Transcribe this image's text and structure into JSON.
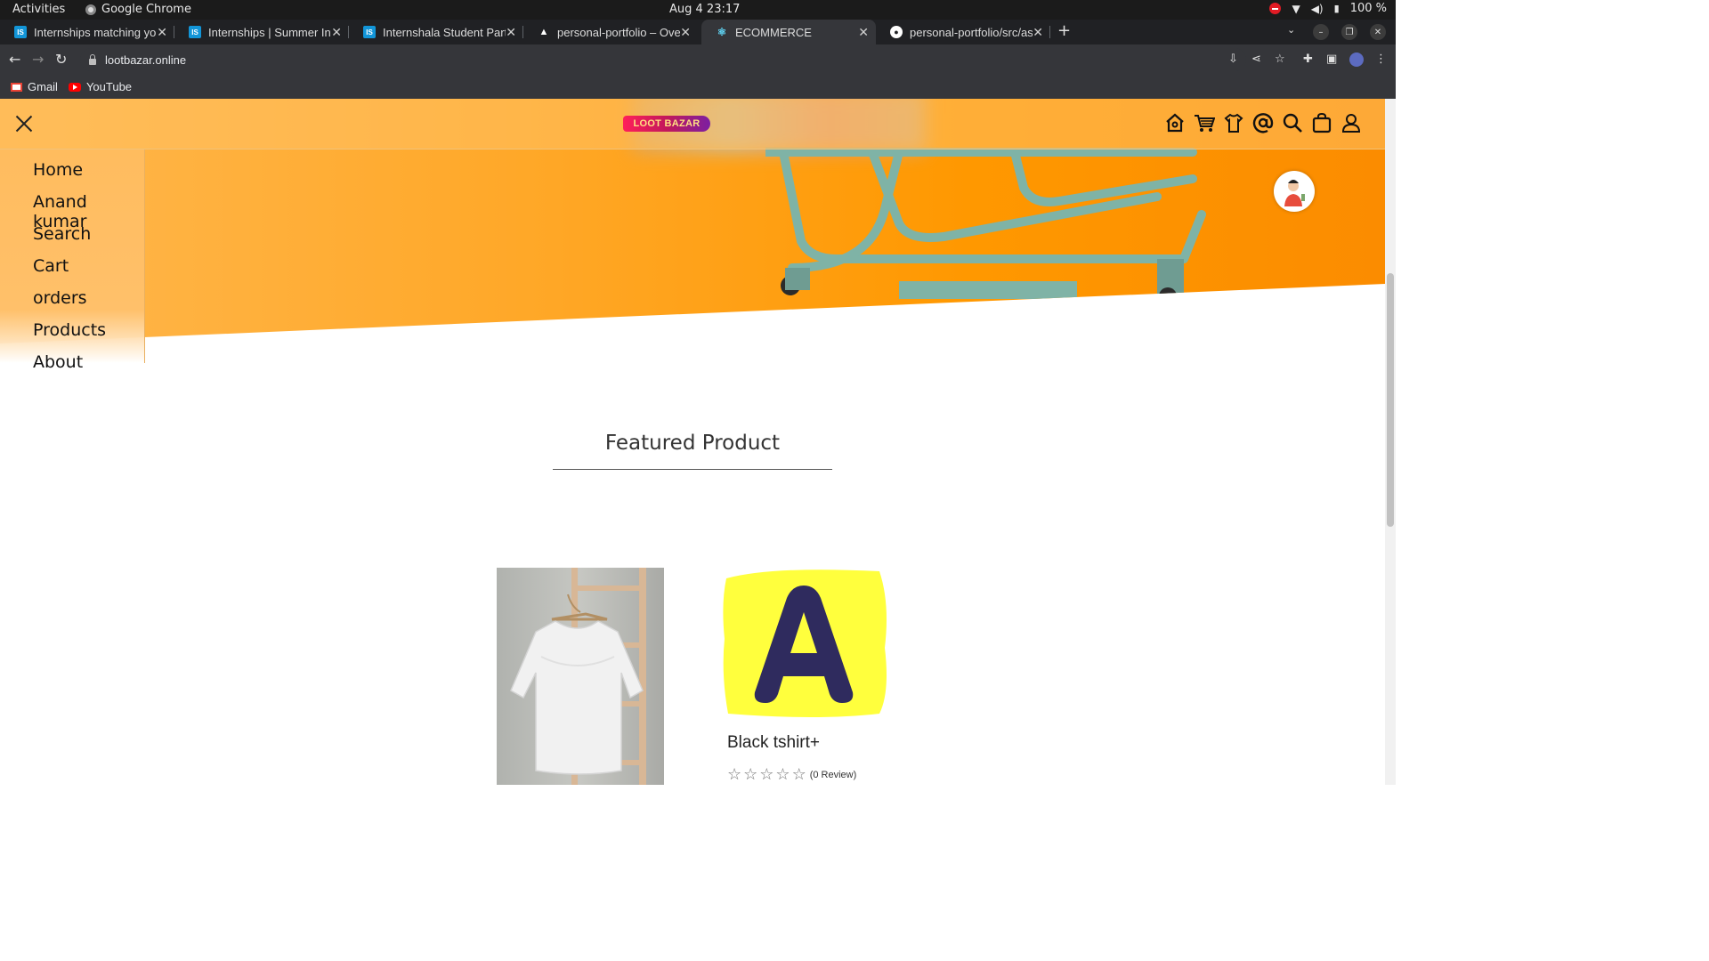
{
  "system_bar": {
    "activities": "Activities",
    "app_name": "Google Chrome",
    "clock": "Aug 4  23:17",
    "battery": "100 %"
  },
  "tabs": [
    {
      "title": "Internships matching you",
      "favicon": "internshala-icon",
      "color": "#1295d8",
      "fav_text": "IS"
    },
    {
      "title": "Internships | Summer Inte",
      "favicon": "internshala-icon",
      "color": "#1295d8",
      "fav_text": "IS"
    },
    {
      "title": "Internshala Student Partr",
      "favicon": "internshala-icon",
      "color": "#1295d8",
      "fav_text": "IS"
    },
    {
      "title": "personal-portfolio – Over",
      "favicon": "vercel-icon",
      "color": "#000000",
      "fav_text": "▲"
    },
    {
      "title": "ECOMMERCE",
      "favicon": "react-icon",
      "color": "#35363a",
      "fav_text": "⚛"
    },
    {
      "title": "personal-portfolio/src/as",
      "favicon": "github-icon",
      "color": "#202124",
      "fav_text": "●"
    }
  ],
  "active_tab_index": 4,
  "address_bar": {
    "url": "lootbazar.online"
  },
  "bookmarks": [
    {
      "label": "Gmail",
      "icon": "gmail-icon"
    },
    {
      "label": "YouTube",
      "icon": "youtube-icon"
    }
  ],
  "site": {
    "logo_text": "LOOT BAZAR",
    "nav_icons": [
      "home-icon",
      "cart-icon",
      "tshirt-icon",
      "at-icon",
      "search-icon",
      "bag-icon",
      "user-icon"
    ],
    "menu": [
      "Home",
      "Anand kumar",
      "Search",
      "Cart",
      "orders",
      "Products",
      "About"
    ],
    "section_title": "Featured Product",
    "products": [
      {
        "name": "Black tshirt+",
        "rating": 0,
        "reviews": "(0 Review)"
      }
    ],
    "brand_letter": "A"
  },
  "colors": {
    "hero_orange": "#ffa726",
    "brand_pink": "#ff1f5a",
    "brand_yellow": "#ffff3d",
    "brand_navy": "#2f2b5e"
  }
}
